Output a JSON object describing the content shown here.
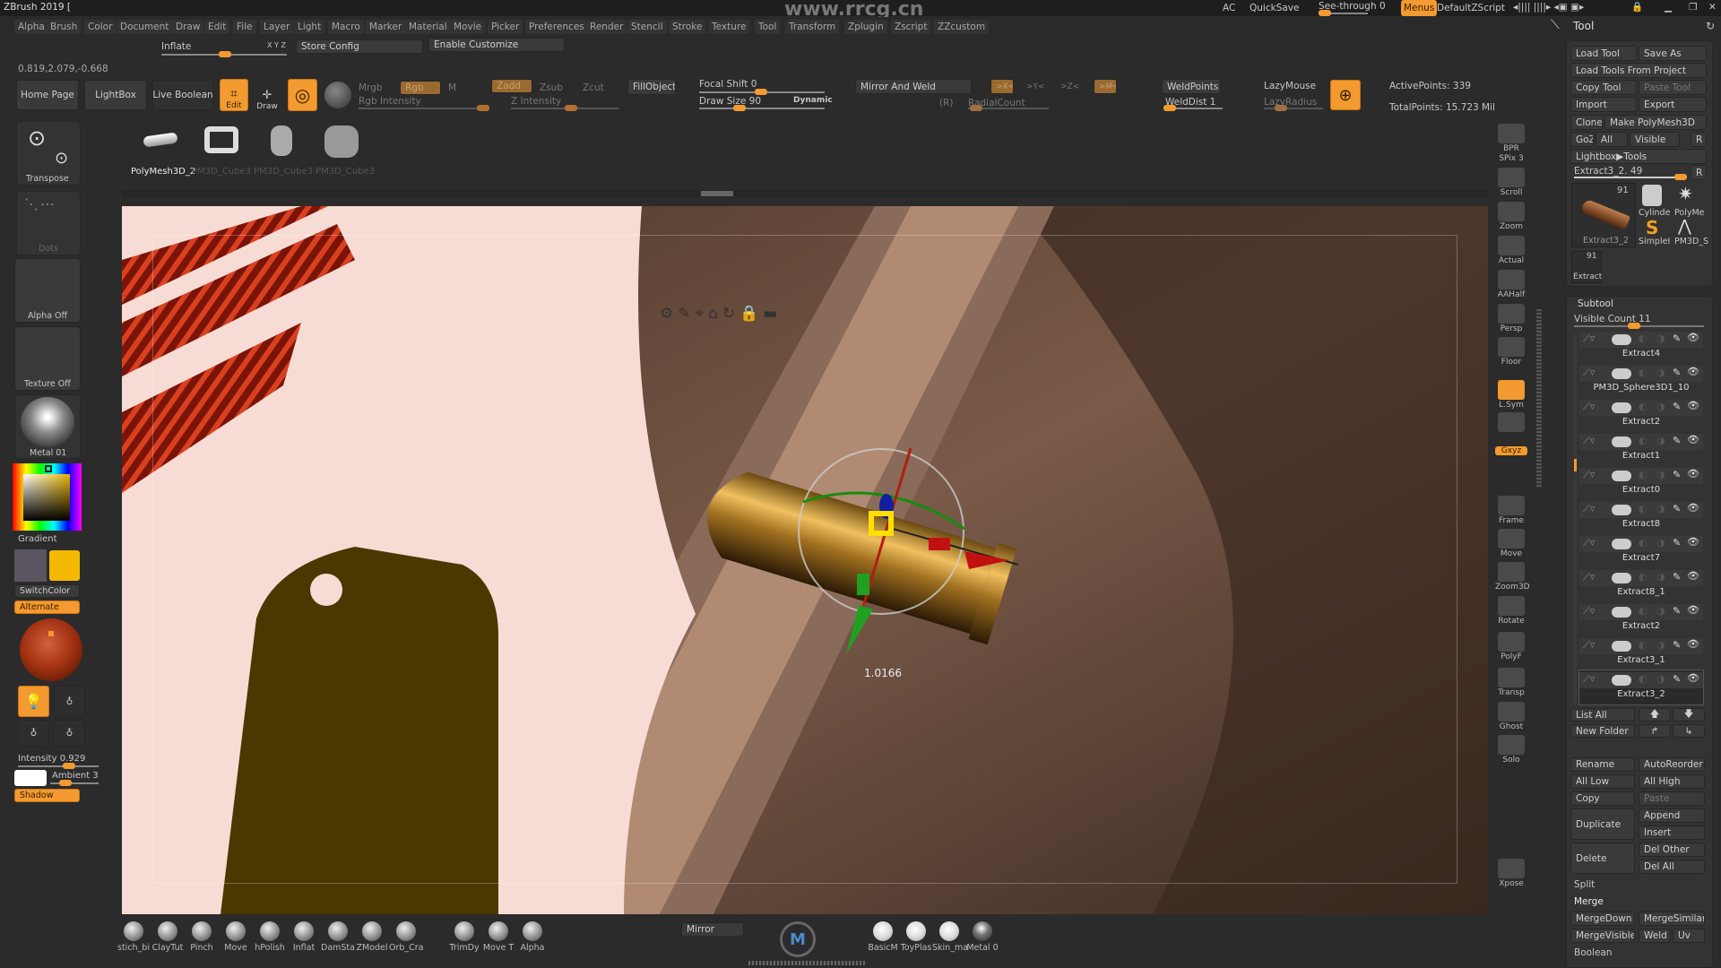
{
  "app": {
    "title": "ZBrush 2019 [",
    "watermark": "www.rrcg.cn"
  },
  "titlebar": {
    "ac": "AC",
    "quicksave": "QuickSave",
    "see_through": "See-through  0",
    "see_through_value": 0,
    "menus": "Menus",
    "script": "DefaultZScript"
  },
  "menus": [
    "Alpha",
    "Brush",
    "Color",
    "Document",
    "Draw",
    "Edit",
    "File",
    "Layer",
    "Light",
    "Macro",
    "Marker",
    "Material",
    "Movie",
    "Picker",
    "Preferences",
    "Render",
    "Stencil",
    "Stroke",
    "Texture",
    "Tool",
    "Transform",
    "Zplugin",
    "Zscript",
    "ZZcustom"
  ],
  "subbar": {
    "inflate": "Inflate",
    "xyz": "X Y Z",
    "store_config": "Store Config",
    "enable_customize": "Enable Customize"
  },
  "coords": "0.819,2.079,-0.668",
  "shelf": {
    "home": "Home Page",
    "lightbox": "LightBox",
    "live_boolean": "Live Boolean",
    "edit": "Edit",
    "draw": "Draw",
    "mrgb": "Mrgb",
    "rgb": "Rgb",
    "m": "M",
    "rgb_intensity": "Rgb Intensity",
    "zadd": "Zadd",
    "zsub": "Zsub",
    "zcut": "Zcut",
    "z_intensity": "Z Intensity",
    "fillobject": "FillObject",
    "focal_shift": "Focal Shift 0",
    "draw_size": "Draw Size 90",
    "dynamic": "Dynamic",
    "mirror_weld": "Mirror And Weld",
    "mx": ">X<",
    "my": ">Y<",
    "mz": ">Z<",
    "mm": ">M<",
    "r": "(R)",
    "radial": "RadialCount",
    "weldpoints": "WeldPoints",
    "welddist": "WeldDist 1",
    "lazymouse": "LazyMouse",
    "lazyradius": "LazyRadius",
    "active_points": "ActivePoints: 339",
    "total_points": "TotalPoints: 15.723 Mil"
  },
  "tool_thumbs": {
    "label": "PolyMesh3D_2",
    "faded": "PM3D_Cube3 PM3D_Cube3 PM3D_Cube3"
  },
  "left": {
    "transpose": "Transpose",
    "dots": "Dots",
    "alpha": "Alpha Off",
    "texture": "Texture Off",
    "material": "Metal 01",
    "gradient": "Gradient",
    "switchcolor": "SwitchColor",
    "alternate": "Alternate",
    "intensity": "Intensity 0.929",
    "ambient": "Ambient 3",
    "shadow": "Shadow",
    "main_color": "#f5b800",
    "secondary_color": "#5a5560"
  },
  "rightshelf": [
    {
      "label": "BPR"
    },
    {
      "label": "SPix 3"
    },
    {
      "label": "Scroll"
    },
    {
      "label": "Zoom"
    },
    {
      "label": "Actual"
    },
    {
      "label": "AAHalf"
    },
    {
      "label": "Persp"
    },
    {
      "label": "Floor"
    },
    {
      "label": "L.Sym",
      "on": true
    },
    {
      "label": ""
    },
    {
      "label": "Gxyz",
      "on": true
    },
    {
      "label": "Frame"
    },
    {
      "label": "Move"
    },
    {
      "label": "Zoom3D"
    },
    {
      "label": "Rotate"
    },
    {
      "label": "PolyF"
    },
    {
      "label": "Transp"
    },
    {
      "label": "Ghost"
    },
    {
      "label": "Solo"
    },
    {
      "label": "Xpose"
    }
  ],
  "tool": {
    "title": "Tool",
    "load_tool": "Load Tool",
    "save_as": "Save As",
    "load_project": "Load Tools From Project",
    "copy_tool": "Copy Tool",
    "paste_tool": "Paste Tool",
    "import": "Import",
    "export": "Export",
    "clone": "Clone",
    "make_polymesh": "Make PolyMesh3D",
    "goz": "GoZ",
    "all": "All",
    "visible": "Visible",
    "r": "R",
    "lightbox_tools": "Lightbox▶Tools",
    "current": "Extract3_2. 49",
    "thumb_main": "Extract3_2",
    "thumb_count": "91",
    "thumb_a": "Cylinde",
    "thumb_b": "PolyMe",
    "thumb_c": "SimpleI",
    "thumb_d": "PM3D_S",
    "thumb_small": "Extract",
    "thumb_small_count": "91"
  },
  "subtool": {
    "title": "Subtool",
    "visible_count": "Visible Count 11",
    "items": [
      "Extract4",
      "PM3D_Sphere3D1_10",
      "Extract2",
      "Extract1",
      "Extract0",
      "Extract8",
      "Extract7",
      "Extract8_1",
      "Extract2",
      "Extract3_1",
      "Extract3_2"
    ],
    "selected": 10,
    "list_all": "List All",
    "new_folder": "New Folder",
    "rename": "Rename",
    "autoreorder": "AutoReorder",
    "all_low": "All Low",
    "all_high": "All High",
    "copy": "Copy",
    "paste": "Paste",
    "duplicate": "Duplicate",
    "append": "Append",
    "insert": "Insert",
    "delete": "Delete",
    "del_other": "Del Other",
    "del_all": "Del All",
    "split": "Split",
    "merge": "Merge",
    "mergedown": "MergeDown",
    "mergesimilar": "MergeSimilar",
    "mergevisible": "MergeVisible",
    "weld": "Weld",
    "uv": "Uv",
    "boolean": "Boolean"
  },
  "viewport": {
    "gizmo_value": "1.0166"
  },
  "bottom": {
    "brushes": [
      "stich_bi",
      "ClayTut",
      "Pinch",
      "Move",
      "hPolish",
      "Inflat",
      "DamSta",
      "ZModel",
      "Orb_Cra",
      "TrimDy",
      "Move T",
      "Alpha"
    ],
    "mirror": "Mirror",
    "materials": [
      "BasicM",
      "ToyPlas",
      "Skin_ma",
      "Metal 0"
    ]
  }
}
